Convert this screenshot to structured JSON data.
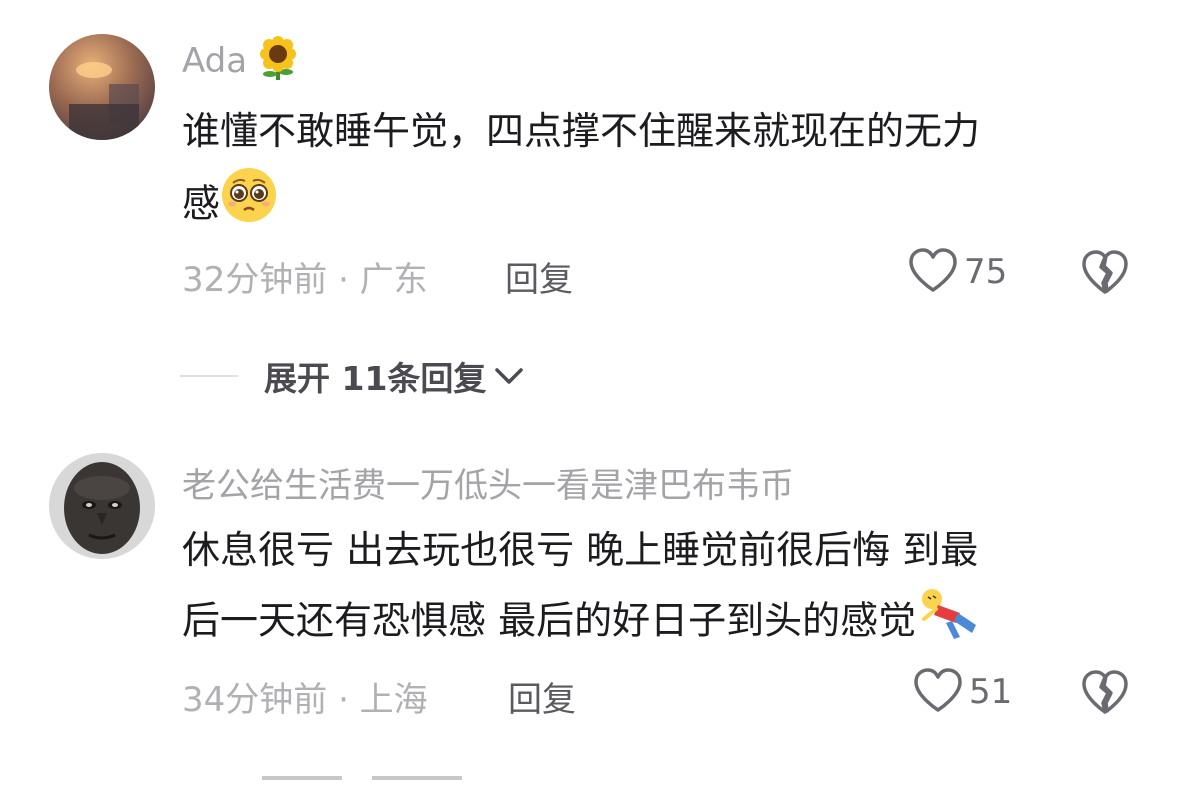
{
  "comments": [
    {
      "username": "Ada",
      "username_emoji": "sunflower-emoji",
      "text_line1": "谁懂不敢睡午觉，四点撑不住醒来就现在的无力",
      "text_line2": "感",
      "text_emoji": "pleading-face-emoji",
      "time_location": "32分钟前 · 广东",
      "reply_label": "回复",
      "like_count": "75"
    },
    {
      "username": "老公给生活费一万低头一看是津巴布韦币",
      "text_line1": "休息很亏 出去玩也很亏 晚上睡觉前很后悔 到最",
      "text_line2": "后一天还有恐惧感 最后的好日子到头的感觉",
      "text_emoji": "falling-person-emoji",
      "time_location": "34分钟前 · 上海",
      "reply_label": "回复",
      "like_count": "51"
    }
  ],
  "expand_replies": {
    "label": "展开 11条回复"
  },
  "icons": {
    "like": "heart-outline-icon",
    "dislike": "broken-heart-icon",
    "expand": "chevron-down-icon"
  },
  "colors": {
    "text": "#1c1c20",
    "meta": "#b0b0b5",
    "icon": "#6a6a70"
  }
}
